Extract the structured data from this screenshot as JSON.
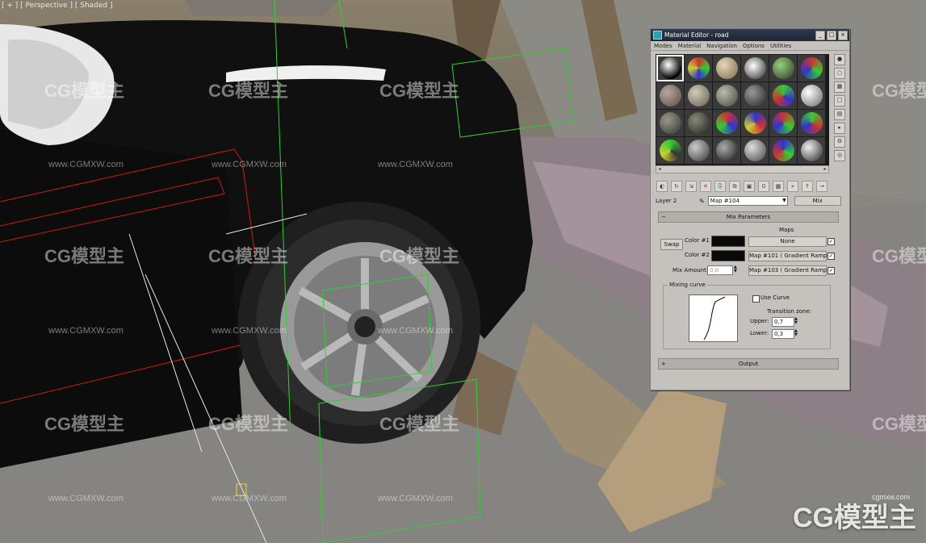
{
  "viewport": {
    "label": "[ + ] [ Perspective ] [ Shaded ]",
    "watermark_text": "CG模型主",
    "watermark_url": "www.CGMXW.com",
    "corner_watermark_text": "CG模型主",
    "corner_watermark_url": "cgmxw.com"
  },
  "material_editor": {
    "title": "Material Editor - road",
    "window_buttons": {
      "minimize": "_",
      "maximize": "□",
      "close": "×"
    },
    "menu": [
      "Modes",
      "Material",
      "Navigation",
      "Options",
      "Utilities"
    ],
    "layer_label": "Layer 2",
    "map_name": "Map #104",
    "map_type": "Mix",
    "rollout_title": "Mix Parameters",
    "maps_header": "Maps",
    "swap_label": "Swap",
    "color1_label": "Color #1",
    "color2_label": "Color #2",
    "map1_label": "None",
    "map2_label": "Map #101  ( Gradient Ramp )",
    "map3_label": "Map #103  ( Gradient Ramp )",
    "mix_amount_label": "Mix Amount:",
    "mix_amount_value": "0,0",
    "mixing_curve_label": "Mixing curve",
    "use_curve_label": "Use Curve",
    "transition_zone_label": "Transition zone:",
    "upper_label": "Upper:",
    "upper_value": "0,7",
    "lower_label": "Lower:",
    "lower_value": "0,3",
    "output_rollout_title": "Output",
    "map1_checked": true,
    "map2_checked": true,
    "map3_checked": true,
    "use_curve_checked": false,
    "colors": {
      "color1": "#0a0a0a",
      "color2": "#0a0a0a",
      "accent": "#2ea0b4"
    }
  }
}
